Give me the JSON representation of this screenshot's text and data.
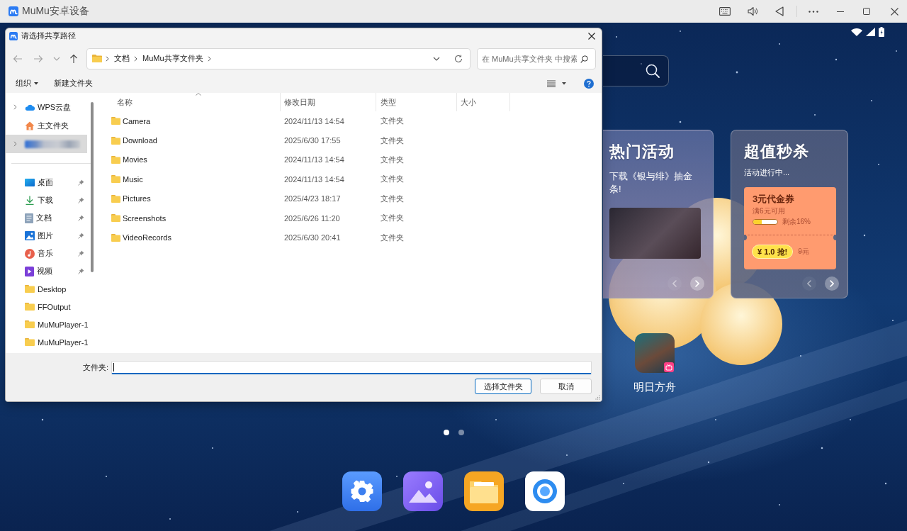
{
  "app": {
    "title": "MuMu安卓设备"
  },
  "dialog": {
    "title": "请选择共享路径",
    "breadcrumb": [
      "文档",
      "MuMu共享文件夹"
    ],
    "search": {
      "placeholder": "在 MuMu共享文件夹 中搜索"
    },
    "toolbar": [
      {
        "label": "组织",
        "menu": true
      },
      {
        "label": "新建文件夹",
        "menu": false
      }
    ],
    "sidebar": {
      "top": [
        {
          "kind": "link",
          "label": "WPS云盘",
          "expandable": true,
          "selected": false
        },
        {
          "kind": "link",
          "label": "主文件夹",
          "expandable": false,
          "selected": false
        },
        {
          "kind": "blurred",
          "expandable": true,
          "selected": true
        }
      ],
      "quick_access": [
        {
          "label": "桌面",
          "pinned": true,
          "selected": false
        },
        {
          "label": "下载",
          "pinned": true,
          "selected": false
        },
        {
          "label": "文档",
          "pinned": true,
          "selected": false
        },
        {
          "label": "图片",
          "pinned": true,
          "selected": false
        },
        {
          "label": "音乐",
          "pinned": true,
          "selected": false
        },
        {
          "label": "视频",
          "pinned": true,
          "selected": false
        },
        {
          "label": "Desktop",
          "pinned": false,
          "selected": false
        },
        {
          "label": "FFOutput",
          "pinned": false,
          "selected": false
        },
        {
          "label": "MuMuPlayer-1",
          "pinned": false,
          "selected": false
        },
        {
          "label": "MuMuPlayer-1",
          "pinned": false,
          "selected": false
        }
      ]
    },
    "columns": [
      {
        "label": "名称",
        "sorted": true
      },
      {
        "label": "修改日期",
        "sorted": false
      },
      {
        "label": "类型",
        "sorted": false
      },
      {
        "label": "大小",
        "sorted": false
      }
    ],
    "rows": [
      {
        "name": "Camera",
        "modified": "2024/11/13 14:54",
        "type": "文件夹",
        "selected": false
      },
      {
        "name": "Download",
        "modified": "2025/6/30 17:55",
        "type": "文件夹",
        "selected": false
      },
      {
        "name": "Movies",
        "modified": "2024/11/13 14:54",
        "type": "文件夹",
        "selected": false
      },
      {
        "name": "Music",
        "modified": "2024/11/13 14:54",
        "type": "文件夹",
        "selected": false
      },
      {
        "name": "Pictures",
        "modified": "2025/4/23 18:17",
        "type": "文件夹",
        "selected": false
      },
      {
        "name": "Screenshots",
        "modified": "2025/6/26 11:20",
        "type": "文件夹",
        "selected": false
      },
      {
        "name": "VideoRecords",
        "modified": "2025/6/30 20:41",
        "type": "文件夹",
        "selected": false
      }
    ],
    "folder_field": {
      "label": "文件夹:"
    },
    "buttons": [
      {
        "label": "选择文件夹",
        "default": true
      },
      {
        "label": "取消",
        "default": false
      }
    ]
  },
  "desktop": {
    "cards": [
      {
        "kind": "activity",
        "title": "热门活动",
        "text": "下载《银与绯》抽金条!",
        "prev_disabled": true,
        "next_disabled": false
      },
      {
        "kind": "flash_sale",
        "title": "超值秒杀",
        "text": "活动进行中...",
        "coupon": {
          "title": "3元代金券",
          "condition": "满6元可用",
          "level": 0.35,
          "remaining": "剩余16%",
          "price": "¥ 1.0 抢!",
          "original_price": "9元"
        },
        "prev_disabled": true,
        "next_disabled": false
      }
    ],
    "apps": [
      {
        "label": "明日方舟"
      }
    ],
    "pages": [
      {
        "selected": true
      },
      {
        "selected": false
      }
    ]
  }
}
